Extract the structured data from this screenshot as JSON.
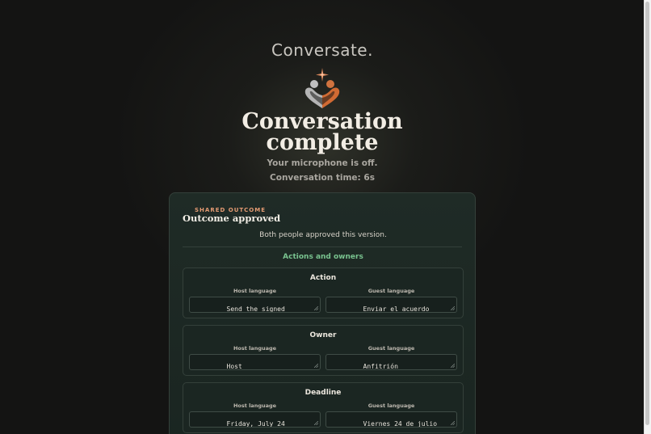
{
  "brand": {
    "name": "Conversate."
  },
  "status": {
    "headline_line1": "Conversation",
    "headline_line2": "complete",
    "mic_status": "Your microphone is off.",
    "conversation_time": "Conversation time: 6s"
  },
  "outcome": {
    "eyebrow": "SHARED OUTCOME",
    "title": "Outcome approved",
    "approval_note": "Both people approved this version.",
    "section_title": "Actions and owners",
    "fields": [
      {
        "title": "Action",
        "host_label": "Host language",
        "guest_label": "Guest language",
        "host_value": "Send the signed agreement. —\nconfirmed",
        "guest_value": "Enviar el acuerdo firmado. —\nconfirmado"
      },
      {
        "title": "Owner",
        "host_label": "Host language",
        "guest_label": "Guest language",
        "host_value": "Host",
        "guest_value": "Anfitrión"
      },
      {
        "title": "Deadline",
        "host_label": "Host language",
        "guest_label": "Guest language",
        "host_value": "Friday, July 24",
        "guest_value": "Viernes 24 de julio"
      }
    ]
  },
  "colors": {
    "accent_orange": "#e59b73",
    "accent_green": "#79c38f",
    "background": "#141413",
    "card": "#1f2b26"
  },
  "icons": {
    "logo": "two-people-heart-logo",
    "resize": "resize-grip-icon"
  }
}
